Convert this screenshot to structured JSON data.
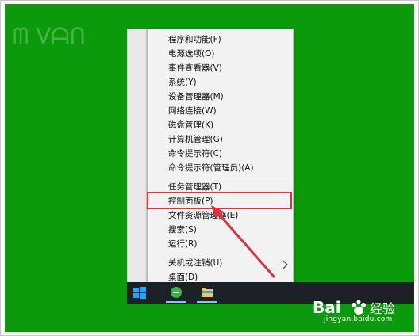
{
  "menu": {
    "items": [
      {
        "label": "程序和功能(F)"
      },
      {
        "label": "电源选项(O)"
      },
      {
        "label": "事件查看器(V)"
      },
      {
        "label": "系统(Y)"
      },
      {
        "label": "设备管理器(M)"
      },
      {
        "label": "网络连接(W)"
      },
      {
        "label": "磁盘管理(K)"
      },
      {
        "label": "计算机管理(G)"
      },
      {
        "label": "命令提示符(C)"
      },
      {
        "label": "命令提示符(管理员)(A)"
      },
      {
        "label": "任务管理器(T)"
      },
      {
        "label": "控制面板(P)"
      },
      {
        "label": "文件资源管理器(E)"
      },
      {
        "label": "搜索(S)"
      },
      {
        "label": "运行(R)"
      },
      {
        "label": "关机或注销(U)"
      },
      {
        "label": "桌面(D)"
      }
    ]
  },
  "watermark": {
    "site": "jingyan.baidu.com",
    "logo_text": "经验"
  },
  "colors": {
    "desktop": "#0b9a0b",
    "highlight": "#e0323b",
    "taskbar": "#1c2125"
  }
}
